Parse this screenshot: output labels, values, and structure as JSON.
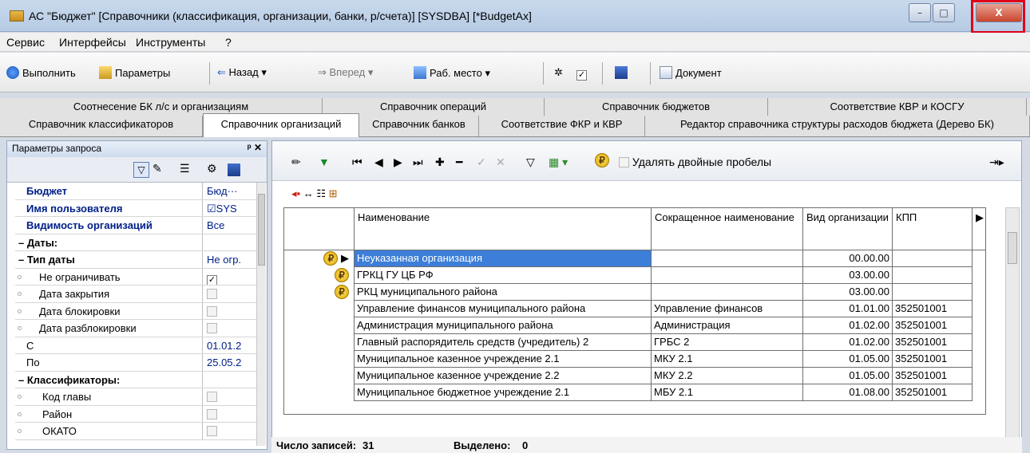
{
  "window": {
    "title": "АС \"Бюджет\" [Справочники (классификация, организации, банки, р/счета)] [SYSDBA] [*BudgetAx]",
    "minimize": "–",
    "maximize": "□",
    "close": "X"
  },
  "menu": [
    "Сервис",
    "Интерфейсы",
    "Инструменты",
    "?"
  ],
  "toolbar": {
    "run": "Выполнить",
    "params": "Параметры",
    "back": "Назад",
    "forward": "Вперед",
    "workplace": "Раб. место",
    "document": "Документ"
  },
  "tabs_row1": [
    "Соотнесение БК л/с и организациям",
    "Справочник операций",
    "Справочник бюджетов",
    "Соответствие КВР и КОСГУ"
  ],
  "tabs_row2": [
    "Справочник классификаторов",
    "Справочник организаций",
    "Справочник банков",
    "Соответствие ФКР и КВР",
    "Редактор справочника структуры расходов бюджета (Дерево БК)"
  ],
  "active_tab": "Справочник организаций",
  "left_panel": {
    "title": "Параметры запроса",
    "pin": "ᵖ ✕",
    "params": [
      {
        "label": "Бюджет",
        "value": "Бюд···",
        "style": "bold"
      },
      {
        "label": "Имя пользователя",
        "value": "☑SYS",
        "style": "bold"
      },
      {
        "label": "Видимость организаций",
        "value": "Все",
        "style": "bold"
      },
      {
        "label": "– Даты:",
        "value": "",
        "style": "sec"
      },
      {
        "label": "– Тип даты",
        "value": "Не огр.",
        "style": "sec"
      },
      {
        "label": "Не ограничивать",
        "value": "",
        "style": "sub",
        "checked": true
      },
      {
        "label": "Дата закрытия",
        "value": "",
        "style": "sub",
        "checked": false
      },
      {
        "label": "Дата блокировки",
        "value": "",
        "style": "sub",
        "checked": false
      },
      {
        "label": "Дата разблокировки",
        "value": "",
        "style": "sub",
        "checked": false
      },
      {
        "label": "С",
        "value": "01.01.2",
        "style": "plain"
      },
      {
        "label": "По",
        "value": "25.05.2",
        "style": "plain"
      },
      {
        "label": "– Классификаторы:",
        "value": "",
        "style": "sec"
      },
      {
        "label": "Код главы",
        "value": "",
        "style": "sub2",
        "checked": false
      },
      {
        "label": "Район",
        "value": "",
        "style": "sub2",
        "checked": false
      },
      {
        "label": "ОКАТО",
        "value": "",
        "style": "sub2",
        "checked": false
      }
    ]
  },
  "main_toolbar": {
    "remove_spaces": "Удалять двойные пробелы"
  },
  "grid": {
    "columns": [
      "Наименование",
      "Сокращенное наименование",
      "Вид организации",
      "КПП"
    ],
    "rows": [
      {
        "name": "Неуказанная организация",
        "short": "",
        "kind": "00.00.00",
        "kpp": "",
        "icon": true
      },
      {
        "name": "ГРКЦ ГУ ЦБ РФ",
        "short": "",
        "kind": "03.00.00",
        "kpp": "",
        "icon": true
      },
      {
        "name": "РКЦ муниципального района",
        "short": "",
        "kind": "03.00.00",
        "kpp": "",
        "icon": true
      },
      {
        "name": "Управление финансов муниципального района",
        "short": "Управление финансов",
        "kind": "01.01.00",
        "kpp": "352501001",
        "icon": false
      },
      {
        "name": "Администрация муниципального района",
        "short": "Администрация",
        "kind": "01.02.00",
        "kpp": "352501001",
        "icon": false
      },
      {
        "name": "Главный распорядитель средств (учредитель) 2",
        "short": "ГРБС 2",
        "kind": "01.02.00",
        "kpp": "352501001",
        "icon": false
      },
      {
        "name": "Муниципальное казенное учреждение 2.1",
        "short": "МКУ 2.1",
        "kind": "01.05.00",
        "kpp": "352501001",
        "icon": false
      },
      {
        "name": "Муниципальное казенное учреждение 2.2",
        "short": "МКУ 2.2",
        "kind": "01.05.00",
        "kpp": "352501001",
        "icon": false
      },
      {
        "name": "Муниципальное бюджетное учреждение 2.1",
        "short": "МБУ 2.1",
        "kind": "01.08.00",
        "kpp": "352501001",
        "icon": false
      }
    ]
  },
  "status": {
    "records_label": "Число записей:",
    "records": "31",
    "selected_label": "Выделено:",
    "selected": "0"
  }
}
